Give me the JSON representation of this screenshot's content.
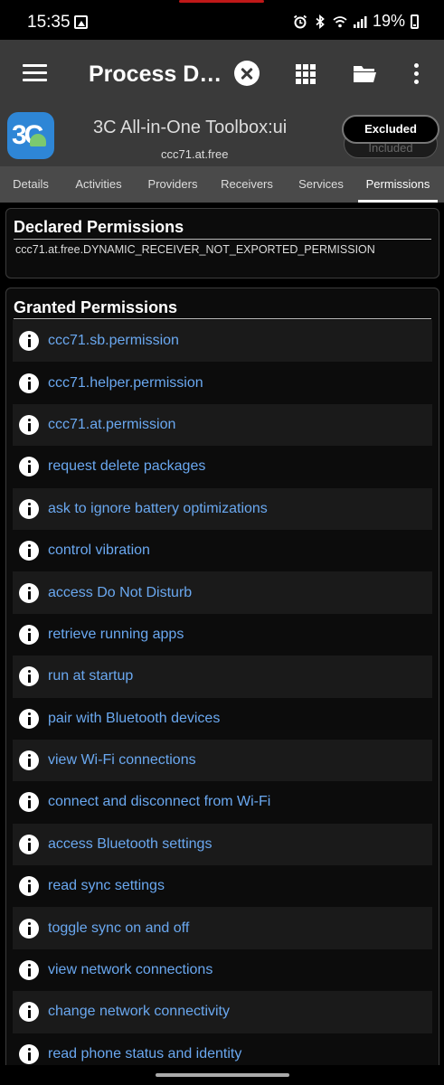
{
  "status_bar": {
    "time": "15:35",
    "battery": "19%",
    "icons": [
      "image-icon",
      "alarm-icon",
      "bluetooth-icon",
      "wifi-icon",
      "signal-icon",
      "battery-icon"
    ]
  },
  "toolbar": {
    "title": "Process D…",
    "icons": [
      "menu-icon",
      "close-icon",
      "grid-icon",
      "folder-icon",
      "more-icon"
    ]
  },
  "app": {
    "name": "3C All-in-One Toolbox:ui",
    "package": "ccc71.at.free",
    "icon_text": "3C",
    "toggle_selected": "Excluded",
    "toggle_other": "Included"
  },
  "tabs": [
    "Details",
    "Activities",
    "Providers",
    "Receivers",
    "Services",
    "Permissions"
  ],
  "active_tab": "Permissions",
  "declared": {
    "title": "Declared Permissions",
    "items": [
      "ccc71.at.free.DYNAMIC_RECEIVER_NOT_EXPORTED_PERMISSION"
    ]
  },
  "granted": {
    "title": "Granted Permissions",
    "items": [
      "ccc71.sb.permission",
      "ccc71.helper.permission",
      "ccc71.at.permission",
      "request delete packages",
      "ask to ignore battery optimizations",
      "control vibration",
      "access Do Not Disturb",
      "retrieve running apps",
      "run at startup",
      "pair with Bluetooth devices",
      "view Wi-Fi connections",
      "connect and disconnect from Wi-Fi",
      "access Bluetooth settings",
      "read sync settings",
      "toggle sync on and off",
      "view network connections",
      "change network connectivity",
      "read phone status and identity"
    ]
  },
  "colors": {
    "toolbar_bg": "#3a3a3a",
    "tabs_bg": "#4a4a4a",
    "link_blue": "#6aa8f0",
    "app_icon_blue": "#2e86d6"
  }
}
